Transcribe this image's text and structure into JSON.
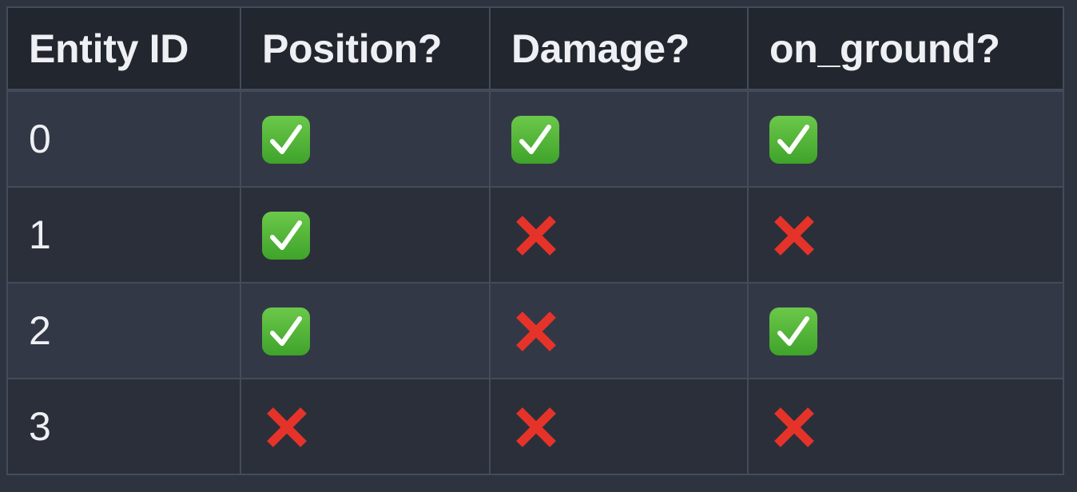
{
  "table": {
    "headers": [
      "Entity ID",
      "Position?",
      "Damage?",
      "on_ground?"
    ],
    "rows": [
      {
        "id": "0",
        "position": "check",
        "damage": "check",
        "on_ground": "check"
      },
      {
        "id": "1",
        "position": "check",
        "damage": "cross",
        "on_ground": "cross"
      },
      {
        "id": "2",
        "position": "check",
        "damage": "cross",
        "on_ground": "check"
      },
      {
        "id": "3",
        "position": "cross",
        "damage": "cross",
        "on_ground": "cross"
      }
    ]
  },
  "icons": {
    "check": "white-heavy-check-mark-icon",
    "cross": "cross-mark-icon"
  },
  "colors": {
    "check_bg": "#52b83a",
    "cross": "#e5332a",
    "header_bg": "#22262e",
    "row_odd_bg": "#333846",
    "row_even_bg": "#2b2f3a",
    "border": "#454b5b"
  }
}
